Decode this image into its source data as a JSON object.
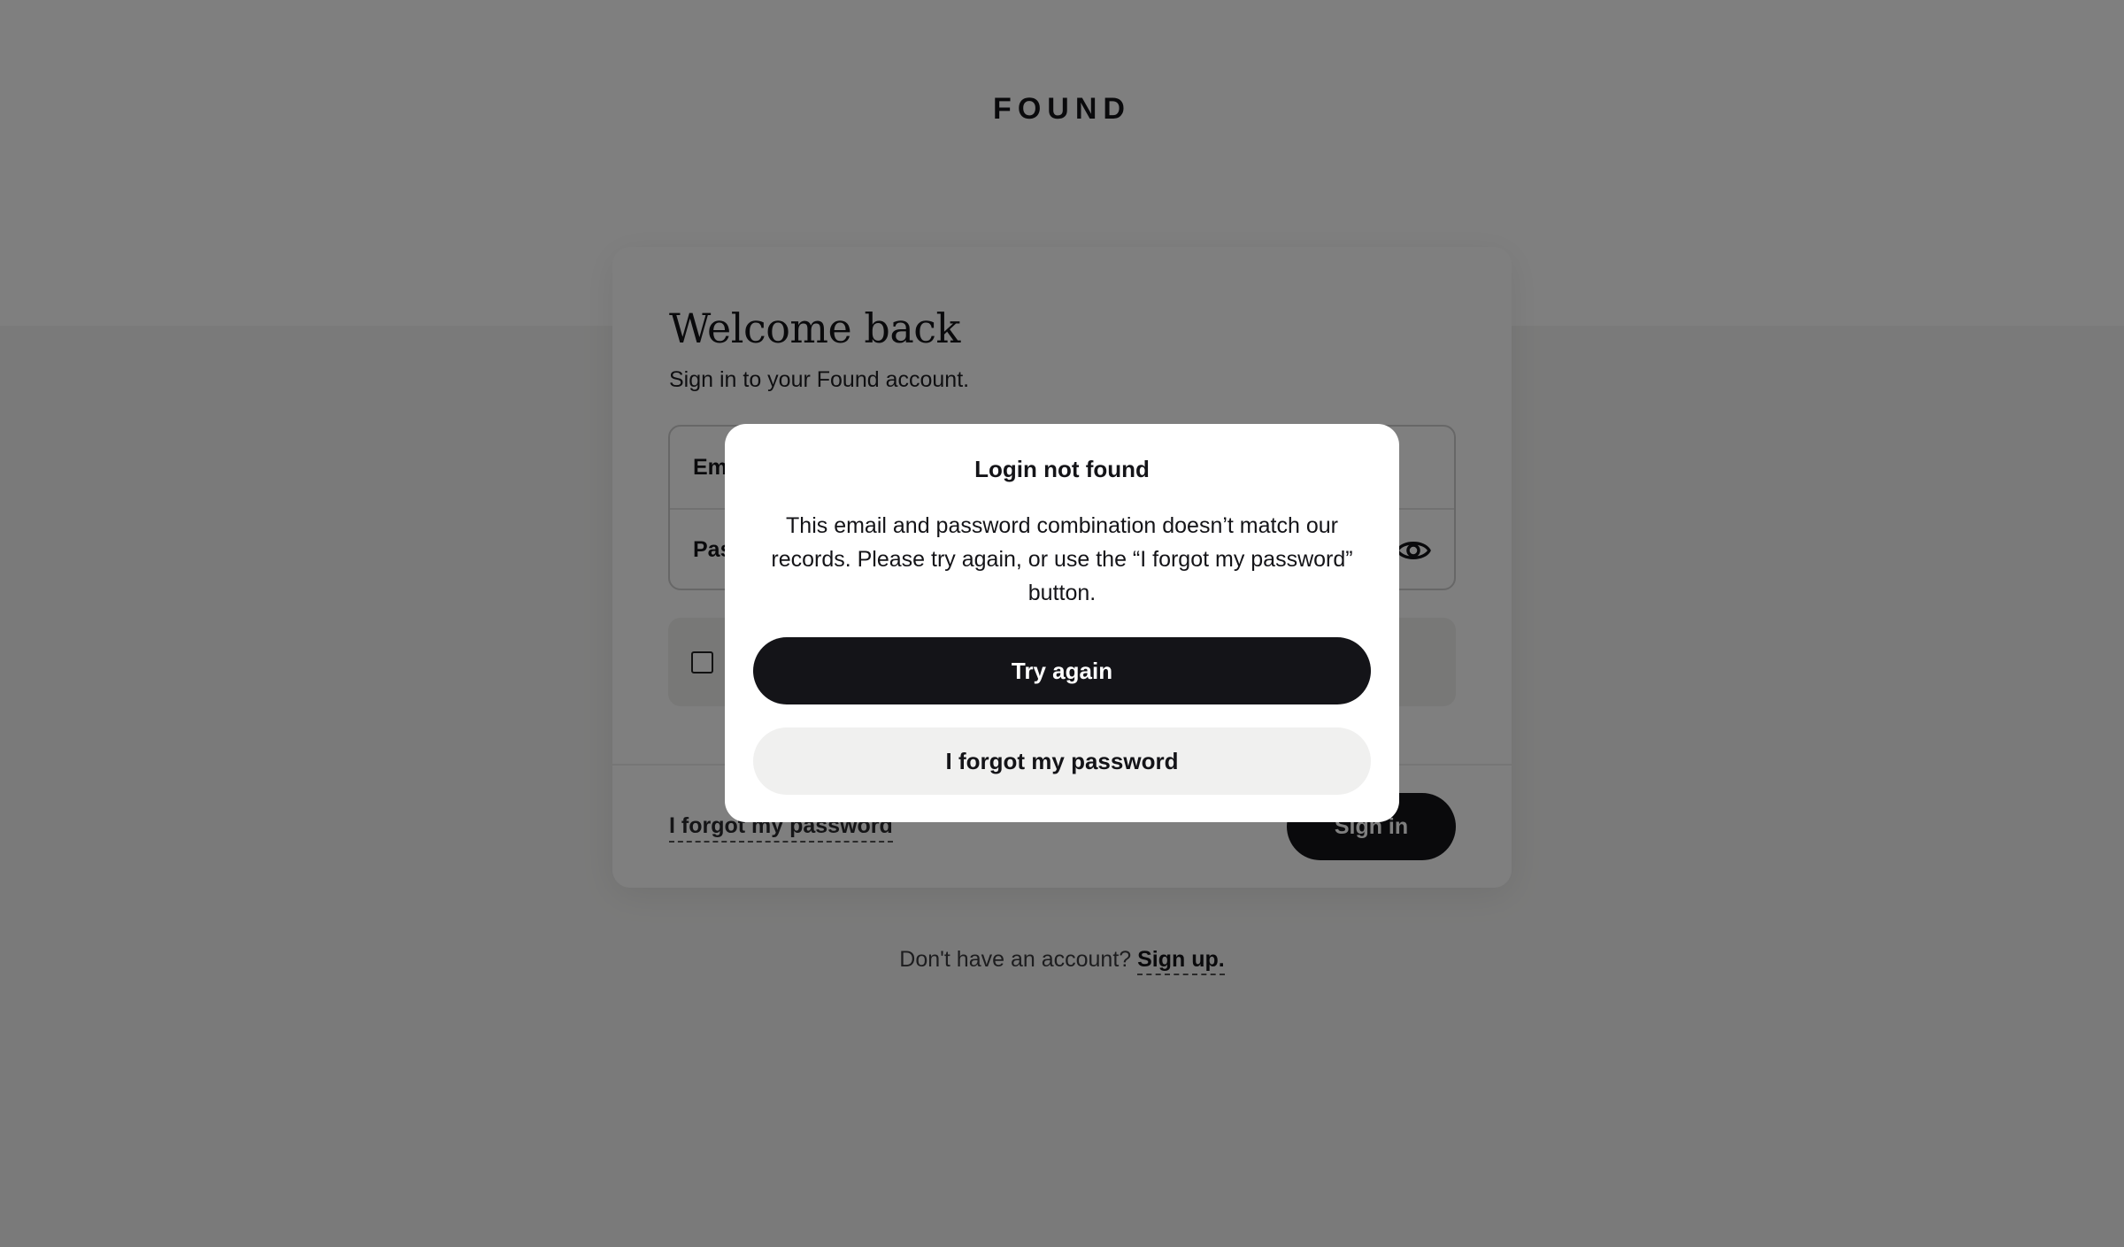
{
  "brand": {
    "logo": "FOUND"
  },
  "login_card": {
    "title": "Welcome back",
    "subtitle": "Sign in to your Found account.",
    "email_field": {
      "label": "Email"
    },
    "password_field": {
      "label": "Password",
      "toggle_icon": "eye-icon"
    },
    "remember_checkbox": {
      "checked": false
    },
    "forgot_link": "I forgot my password",
    "signin_button": "Sign in"
  },
  "signup": {
    "prompt": "Don't have an account?",
    "link": "Sign up."
  },
  "modal": {
    "title": "Login not found",
    "body": "This email and password combination doesn’t match our records. Please try again, or use the “I forgot my password” button.",
    "primary_button": "Try again",
    "secondary_button": "I forgot my password"
  },
  "colors": {
    "primary": "#141418",
    "secondary_button_bg": "#f0f0ef",
    "overlay": "rgba(0,0,0,0.5)"
  }
}
